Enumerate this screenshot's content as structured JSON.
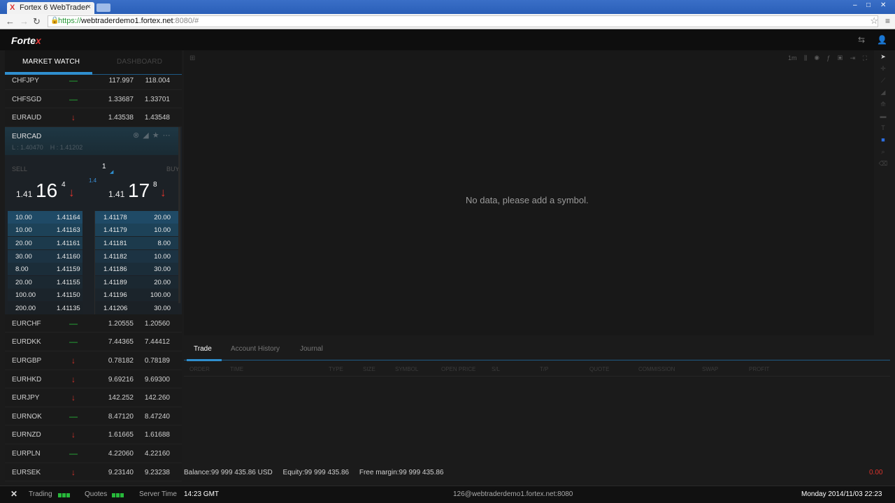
{
  "browser": {
    "tab_title": "Fortex 6 WebTrader",
    "tab_close": "×",
    "url_https": "https://",
    "url_host": "webtraderdemo1.fortex.net",
    "url_rest": ":8080/#"
  },
  "app": {
    "logo_main": "Forte",
    "logo_x": "x"
  },
  "left_tabs": {
    "market_watch": "MARKET WATCH",
    "dashboard": "DASHBOARD"
  },
  "rows_top": [
    {
      "symbol": "CHFJPY",
      "dir": "—",
      "bid": "117.997",
      "ask": "118.004",
      "flat": true
    },
    {
      "symbol": "CHFSGD",
      "dir": "—",
      "bid": "1.33687",
      "ask": "1.33701",
      "flat": true
    },
    {
      "symbol": "EURAUD",
      "dir": "↓",
      "bid": "1.43538",
      "ask": "1.43548",
      "flat": false
    }
  ],
  "expanded": {
    "symbol": "EURCAD",
    "low": "L : 1.40470",
    "high": "H : 1.41202",
    "sell_label": "SELL",
    "buy_label": "BUY",
    "quantity": "1",
    "spread": "1.4",
    "sell_prefix": "1.41",
    "sell_big": "16",
    "sell_sup": "4",
    "buy_prefix": "1.41",
    "buy_big": "17",
    "buy_sup": "8",
    "depth": [
      {
        "bv": "10.00",
        "bp": "1.41164",
        "ap": "1.41178",
        "av": "20.00"
      },
      {
        "bv": "10.00",
        "bp": "1.41163",
        "ap": "1.41179",
        "av": "10.00"
      },
      {
        "bv": "20.00",
        "bp": "1.41161",
        "ap": "1.41181",
        "av": "8.00"
      },
      {
        "bv": "30.00",
        "bp": "1.41160",
        "ap": "1.41182",
        "av": "10.00"
      },
      {
        "bv": "8.00",
        "bp": "1.41159",
        "ap": "1.41186",
        "av": "30.00"
      },
      {
        "bv": "20.00",
        "bp": "1.41155",
        "ap": "1.41189",
        "av": "20.00"
      },
      {
        "bv": "100.00",
        "bp": "1.41150",
        "ap": "1.41196",
        "av": "100.00"
      },
      {
        "bv": "200.00",
        "bp": "1.41135",
        "ap": "1.41206",
        "av": "30.00"
      }
    ]
  },
  "rows_bottom": [
    {
      "symbol": "EURCHF",
      "dir": "—",
      "bid": "1.20555",
      "ask": "1.20560",
      "flat": true
    },
    {
      "symbol": "EURDKK",
      "dir": "—",
      "bid": "7.44365",
      "ask": "7.44412",
      "flat": true
    },
    {
      "symbol": "EURGBP",
      "dir": "↓",
      "bid": "0.78182",
      "ask": "0.78189",
      "flat": false
    },
    {
      "symbol": "EURHKD",
      "dir": "↓",
      "bid": "9.69216",
      "ask": "9.69300",
      "flat": false
    },
    {
      "symbol": "EURJPY",
      "dir": "↓",
      "bid": "142.252",
      "ask": "142.260",
      "flat": false
    },
    {
      "symbol": "EURNOK",
      "dir": "—",
      "bid": "8.47120",
      "ask": "8.47240",
      "flat": true
    },
    {
      "symbol": "EURNZD",
      "dir": "↓",
      "bid": "1.61665",
      "ask": "1.61688",
      "flat": false
    },
    {
      "symbol": "EURPLN",
      "dir": "—",
      "bid": "4.22060",
      "ask": "4.22160",
      "flat": true
    },
    {
      "symbol": "EURSEK",
      "dir": "↓",
      "bid": "9.23140",
      "ask": "9.23238",
      "flat": false
    }
  ],
  "chart": {
    "empty_message": "No data, please add a symbol.",
    "timeframe": "1m"
  },
  "bottom_tabs": {
    "trade": "Trade",
    "account_history": "Account History",
    "journal": "Journal"
  },
  "columns": [
    "ORDER",
    "TIME",
    "TYPE",
    "SIZE",
    "SYMBOL",
    "OPEN PRICE",
    "S/L",
    "T/P",
    "QUOTE",
    "COMMISSION",
    "SWAP",
    "PROFIT"
  ],
  "balances": {
    "balance": "Balance:99 999 435.86 USD",
    "equity": "Equity:99 999 435.86",
    "free_margin": "Free margin:99 999 435.86",
    "pnl": "0.00"
  },
  "status": {
    "trading": "Trading",
    "quotes": "Quotes",
    "server_time_label": "Server Time",
    "server_time": "14:23 GMT",
    "account": "126@webtraderdemo1.fortex.net:8080",
    "datetime": "Monday 2014/11/03 22:23"
  }
}
